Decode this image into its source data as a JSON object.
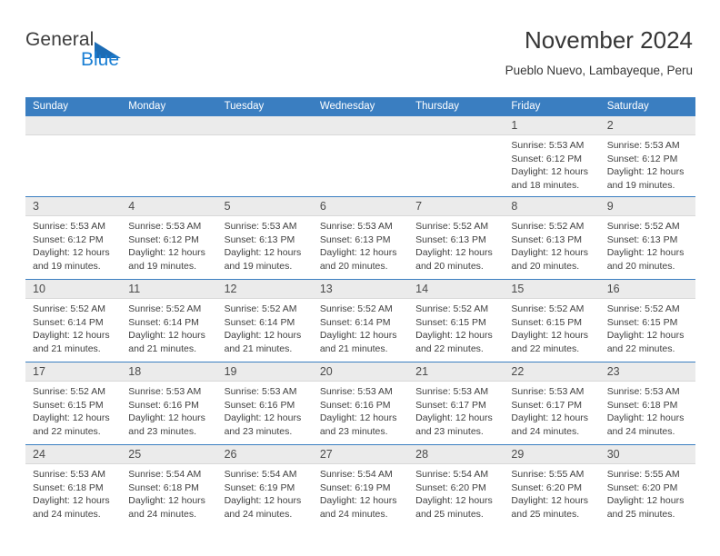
{
  "brand": {
    "name_top": "General",
    "name_bottom": "Blue",
    "triangle_color": "#1c6cb5",
    "blue_color": "#1a7fd4"
  },
  "header": {
    "title": "November 2024",
    "subtitle": "Pueblo Nuevo, Lambayeque, Peru"
  },
  "colors": {
    "header_blue": "#3a7ec1",
    "daynum_band": "#ebebeb",
    "text": "#3f3f3f"
  },
  "weekdays": [
    "Sunday",
    "Monday",
    "Tuesday",
    "Wednesday",
    "Thursday",
    "Friday",
    "Saturday"
  ],
  "labels": {
    "sunrise": "Sunrise:",
    "sunset": "Sunset:",
    "daylight": "Daylight:"
  },
  "weeks": [
    [
      {
        "day": ""
      },
      {
        "day": ""
      },
      {
        "day": ""
      },
      {
        "day": ""
      },
      {
        "day": ""
      },
      {
        "day": "1",
        "sunrise": "Sunrise: 5:53 AM",
        "sunset": "Sunset: 6:12 PM",
        "daylight_1": "Daylight: 12 hours",
        "daylight_2": "and 18 minutes."
      },
      {
        "day": "2",
        "sunrise": "Sunrise: 5:53 AM",
        "sunset": "Sunset: 6:12 PM",
        "daylight_1": "Daylight: 12 hours",
        "daylight_2": "and 19 minutes."
      }
    ],
    [
      {
        "day": "3",
        "sunrise": "Sunrise: 5:53 AM",
        "sunset": "Sunset: 6:12 PM",
        "daylight_1": "Daylight: 12 hours",
        "daylight_2": "and 19 minutes."
      },
      {
        "day": "4",
        "sunrise": "Sunrise: 5:53 AM",
        "sunset": "Sunset: 6:12 PM",
        "daylight_1": "Daylight: 12 hours",
        "daylight_2": "and 19 minutes."
      },
      {
        "day": "5",
        "sunrise": "Sunrise: 5:53 AM",
        "sunset": "Sunset: 6:13 PM",
        "daylight_1": "Daylight: 12 hours",
        "daylight_2": "and 19 minutes."
      },
      {
        "day": "6",
        "sunrise": "Sunrise: 5:53 AM",
        "sunset": "Sunset: 6:13 PM",
        "daylight_1": "Daylight: 12 hours",
        "daylight_2": "and 20 minutes."
      },
      {
        "day": "7",
        "sunrise": "Sunrise: 5:52 AM",
        "sunset": "Sunset: 6:13 PM",
        "daylight_1": "Daylight: 12 hours",
        "daylight_2": "and 20 minutes."
      },
      {
        "day": "8",
        "sunrise": "Sunrise: 5:52 AM",
        "sunset": "Sunset: 6:13 PM",
        "daylight_1": "Daylight: 12 hours",
        "daylight_2": "and 20 minutes."
      },
      {
        "day": "9",
        "sunrise": "Sunrise: 5:52 AM",
        "sunset": "Sunset: 6:13 PM",
        "daylight_1": "Daylight: 12 hours",
        "daylight_2": "and 20 minutes."
      }
    ],
    [
      {
        "day": "10",
        "sunrise": "Sunrise: 5:52 AM",
        "sunset": "Sunset: 6:14 PM",
        "daylight_1": "Daylight: 12 hours",
        "daylight_2": "and 21 minutes."
      },
      {
        "day": "11",
        "sunrise": "Sunrise: 5:52 AM",
        "sunset": "Sunset: 6:14 PM",
        "daylight_1": "Daylight: 12 hours",
        "daylight_2": "and 21 minutes."
      },
      {
        "day": "12",
        "sunrise": "Sunrise: 5:52 AM",
        "sunset": "Sunset: 6:14 PM",
        "daylight_1": "Daylight: 12 hours",
        "daylight_2": "and 21 minutes."
      },
      {
        "day": "13",
        "sunrise": "Sunrise: 5:52 AM",
        "sunset": "Sunset: 6:14 PM",
        "daylight_1": "Daylight: 12 hours",
        "daylight_2": "and 21 minutes."
      },
      {
        "day": "14",
        "sunrise": "Sunrise: 5:52 AM",
        "sunset": "Sunset: 6:15 PM",
        "daylight_1": "Daylight: 12 hours",
        "daylight_2": "and 22 minutes."
      },
      {
        "day": "15",
        "sunrise": "Sunrise: 5:52 AM",
        "sunset": "Sunset: 6:15 PM",
        "daylight_1": "Daylight: 12 hours",
        "daylight_2": "and 22 minutes."
      },
      {
        "day": "16",
        "sunrise": "Sunrise: 5:52 AM",
        "sunset": "Sunset: 6:15 PM",
        "daylight_1": "Daylight: 12 hours",
        "daylight_2": "and 22 minutes."
      }
    ],
    [
      {
        "day": "17",
        "sunrise": "Sunrise: 5:52 AM",
        "sunset": "Sunset: 6:15 PM",
        "daylight_1": "Daylight: 12 hours",
        "daylight_2": "and 22 minutes."
      },
      {
        "day": "18",
        "sunrise": "Sunrise: 5:53 AM",
        "sunset": "Sunset: 6:16 PM",
        "daylight_1": "Daylight: 12 hours",
        "daylight_2": "and 23 minutes."
      },
      {
        "day": "19",
        "sunrise": "Sunrise: 5:53 AM",
        "sunset": "Sunset: 6:16 PM",
        "daylight_1": "Daylight: 12 hours",
        "daylight_2": "and 23 minutes."
      },
      {
        "day": "20",
        "sunrise": "Sunrise: 5:53 AM",
        "sunset": "Sunset: 6:16 PM",
        "daylight_1": "Daylight: 12 hours",
        "daylight_2": "and 23 minutes."
      },
      {
        "day": "21",
        "sunrise": "Sunrise: 5:53 AM",
        "sunset": "Sunset: 6:17 PM",
        "daylight_1": "Daylight: 12 hours",
        "daylight_2": "and 23 minutes."
      },
      {
        "day": "22",
        "sunrise": "Sunrise: 5:53 AM",
        "sunset": "Sunset: 6:17 PM",
        "daylight_1": "Daylight: 12 hours",
        "daylight_2": "and 24 minutes."
      },
      {
        "day": "23",
        "sunrise": "Sunrise: 5:53 AM",
        "sunset": "Sunset: 6:18 PM",
        "daylight_1": "Daylight: 12 hours",
        "daylight_2": "and 24 minutes."
      }
    ],
    [
      {
        "day": "24",
        "sunrise": "Sunrise: 5:53 AM",
        "sunset": "Sunset: 6:18 PM",
        "daylight_1": "Daylight: 12 hours",
        "daylight_2": "and 24 minutes."
      },
      {
        "day": "25",
        "sunrise": "Sunrise: 5:54 AM",
        "sunset": "Sunset: 6:18 PM",
        "daylight_1": "Daylight: 12 hours",
        "daylight_2": "and 24 minutes."
      },
      {
        "day": "26",
        "sunrise": "Sunrise: 5:54 AM",
        "sunset": "Sunset: 6:19 PM",
        "daylight_1": "Daylight: 12 hours",
        "daylight_2": "and 24 minutes."
      },
      {
        "day": "27",
        "sunrise": "Sunrise: 5:54 AM",
        "sunset": "Sunset: 6:19 PM",
        "daylight_1": "Daylight: 12 hours",
        "daylight_2": "and 24 minutes."
      },
      {
        "day": "28",
        "sunrise": "Sunrise: 5:54 AM",
        "sunset": "Sunset: 6:20 PM",
        "daylight_1": "Daylight: 12 hours",
        "daylight_2": "and 25 minutes."
      },
      {
        "day": "29",
        "sunrise": "Sunrise: 5:55 AM",
        "sunset": "Sunset: 6:20 PM",
        "daylight_1": "Daylight: 12 hours",
        "daylight_2": "and 25 minutes."
      },
      {
        "day": "30",
        "sunrise": "Sunrise: 5:55 AM",
        "sunset": "Sunset: 6:20 PM",
        "daylight_1": "Daylight: 12 hours",
        "daylight_2": "and 25 minutes."
      }
    ]
  ]
}
